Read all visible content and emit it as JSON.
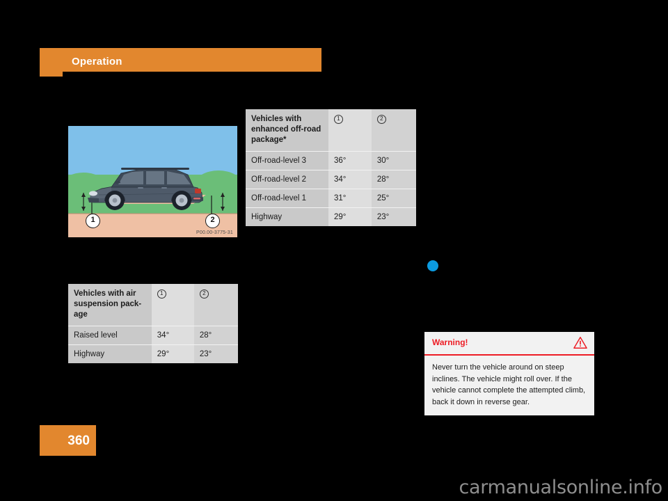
{
  "header": {
    "title": "Operation",
    "accent_color": "#E2872E"
  },
  "page_footer": {
    "page_number": "360",
    "accent_color": "#E2872E"
  },
  "illustration": {
    "alt_name": "vehicle-on-incline-diagram",
    "image_code": "P00.00-3775-31",
    "callout_1": "1",
    "callout_2": "2",
    "sky_color": "#7FC0EA",
    "grass_color": "#6BBE78",
    "ground_color": "#EFC0A4",
    "vehicle_color": "#4A5665"
  },
  "table_offroad": {
    "header_label": "Vehicles with enhanced off-road package*",
    "col1_symbol": "1",
    "col2_symbol": "2",
    "rows": [
      {
        "label": "Off-road-level 3",
        "angle1": "36°",
        "angle2": "30°"
      },
      {
        "label": "Off-road-level 2",
        "angle1": "34°",
        "angle2": "28°"
      },
      {
        "label": "Off-road-level 1",
        "angle1": "31°",
        "angle2": "25°"
      },
      {
        "label": "Highway",
        "angle1": "29°",
        "angle2": "23°"
      }
    ]
  },
  "table_airsuspension": {
    "header_label": "Vehicles with air suspension pack-age",
    "col1_symbol": "1",
    "col2_symbol": "2",
    "rows": [
      {
        "label": "Raised level",
        "angle1": "34°",
        "angle2": "28°"
      },
      {
        "label": "Highway",
        "angle1": "29°",
        "angle2": "23°"
      }
    ]
  },
  "marker": {
    "bullet_color": "#0C9BE0"
  },
  "warning": {
    "title": "Warning!",
    "icon": "warning-triangle-icon",
    "accent_color": "#ED1C24",
    "body": "Never turn the vehicle around on steep inclines. The vehicle might roll over. If the vehicle cannot complete the attempted climb, back it down in reverse gear."
  },
  "watermark": {
    "text": "carmanualsonline.info"
  }
}
